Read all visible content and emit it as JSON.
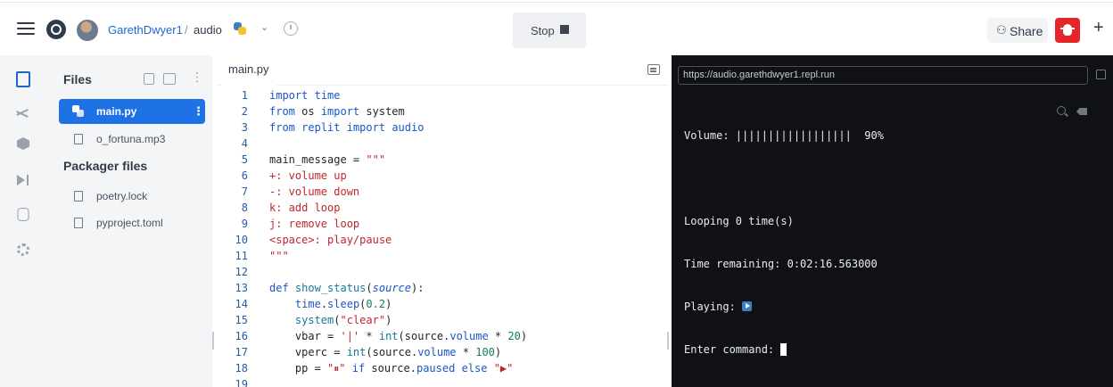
{
  "header": {
    "username": "GarethDwyer1",
    "separator": "/",
    "repl_name": "audio",
    "stop_label": "Stop",
    "share_label": "Share",
    "plus_label": "+"
  },
  "files_panel": {
    "title": "Files",
    "more_label": "⋮",
    "items": [
      {
        "name": "main.py",
        "active": true
      },
      {
        "name": "o_fortuna.mp3",
        "active": false
      }
    ],
    "packager_title": "Packager files",
    "packager_items": [
      {
        "name": "poetry.lock"
      },
      {
        "name": "pyproject.toml"
      }
    ]
  },
  "editor": {
    "tab_label": "main.py",
    "lines": [
      {
        "n": "1",
        "text": "import time"
      },
      {
        "n": "2",
        "text": "from os import system"
      },
      {
        "n": "3",
        "text": "from replit import audio"
      },
      {
        "n": "4",
        "text": ""
      },
      {
        "n": "5",
        "text": "main_message = \"\"\""
      },
      {
        "n": "6",
        "text": "+: volume up"
      },
      {
        "n": "7",
        "text": "-: volume down"
      },
      {
        "n": "8",
        "text": "k: add loop"
      },
      {
        "n": "9",
        "text": "j: remove loop"
      },
      {
        "n": "10",
        "text": "<space>: play/pause"
      },
      {
        "n": "11",
        "text": "\"\"\""
      },
      {
        "n": "12",
        "text": ""
      },
      {
        "n": "13",
        "text": "def show_status(source):"
      },
      {
        "n": "14",
        "text": "    time.sleep(0.2)"
      },
      {
        "n": "15",
        "text": "    system(\"clear\")"
      },
      {
        "n": "16",
        "text": "    vbar = '|' * int(source.volume * 20)"
      },
      {
        "n": "17",
        "text": "    vperc = int(source.volume * 100)"
      },
      {
        "n": "18",
        "text": "    pp = \"⏸\" if source.paused else \"▶\""
      },
      {
        "n": "19",
        "text": ""
      }
    ]
  },
  "console": {
    "url": "https://audio.garethdwyer1.repl.run",
    "volume_line": "Volume: ||||||||||||||||||  90%",
    "looping_line": "Looping 0 time(s)",
    "remaining_line": "Time remaining: 0:02:16.563000",
    "playing_label": "Playing: ",
    "command_label": "Enter command: "
  },
  "colors": {
    "accent": "#1f72e6",
    "link": "#1f66cf",
    "bug_button": "#e5252a",
    "console_bg": "#0f1115"
  },
  "icons": [
    "hamburger-icon",
    "replit-logo",
    "python-icon",
    "chevron-down-icon",
    "history-icon",
    "stop-icon",
    "share-icon",
    "bug-icon",
    "plus-icon",
    "files-icon",
    "version-control-icon",
    "packages-icon",
    "debugger-icon",
    "database-icon",
    "settings-icon",
    "new-file-icon",
    "new-folder-icon",
    "file-icon",
    "editor-menu-icon",
    "open-new-tab-icon",
    "search-icon",
    "clear-console-icon"
  ]
}
